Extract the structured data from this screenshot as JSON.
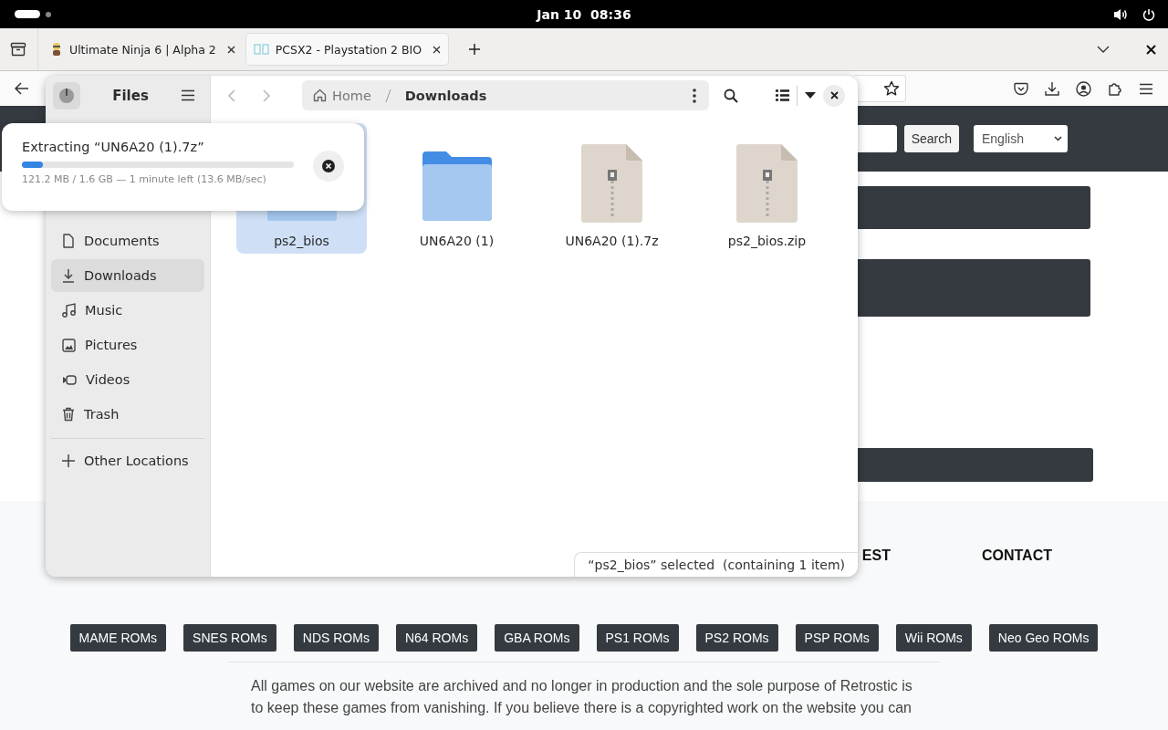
{
  "top_bar": {
    "date": "Jan 10",
    "time": "08:36"
  },
  "browser": {
    "tabs": [
      {
        "title": "Ultimate Ninja 6 | Alpha 2",
        "selected": false
      },
      {
        "title": "PCSX2 - Playstation 2 BIO",
        "selected": true
      }
    ],
    "page": {
      "search_button": "Search",
      "language": "English",
      "footer_nav": [
        "EST",
        "CONTACT"
      ],
      "rom_links": [
        "MAME ROMs",
        "SNES ROMs",
        "NDS ROMs",
        "N64 ROMs",
        "GBA ROMs",
        "PS1 ROMs",
        "PS2 ROMs",
        "PSP ROMs",
        "Wii ROMs",
        "Neo Geo ROMs"
      ],
      "disclaimer": "All games on our website are archived and no longer in production and the sole purpose of Retrostic is to keep these games from vanishing. If you believe there is a copyrighted work on the website you can"
    }
  },
  "files": {
    "title": "Files",
    "path": [
      "Home",
      "Downloads"
    ],
    "sidebar": [
      {
        "label": "Documents",
        "selected": false
      },
      {
        "label": "Downloads",
        "selected": true
      },
      {
        "label": "Music",
        "selected": false
      },
      {
        "label": "Pictures",
        "selected": false
      },
      {
        "label": "Videos",
        "selected": false
      },
      {
        "label": "Trash",
        "selected": false
      }
    ],
    "other_locations": "Other Locations",
    "items": [
      {
        "name": "ps2_bios",
        "kind": "folder",
        "selected": true
      },
      {
        "name": "UN6A20 (1)",
        "kind": "folder",
        "selected": false
      },
      {
        "name": "UN6A20 (1).7z",
        "kind": "archive",
        "selected": false
      },
      {
        "name": "ps2_bios.zip",
        "kind": "archive",
        "selected": false
      }
    ],
    "status": "“ps2_bios” selected  (containing 1 item)"
  },
  "progress": {
    "title": "Extracting “UN6A20 (1).7z”",
    "level": 0.076,
    "detail": "121.2 MB / 1.6 GB — 1 minute left (13.6 MB/sec)"
  }
}
